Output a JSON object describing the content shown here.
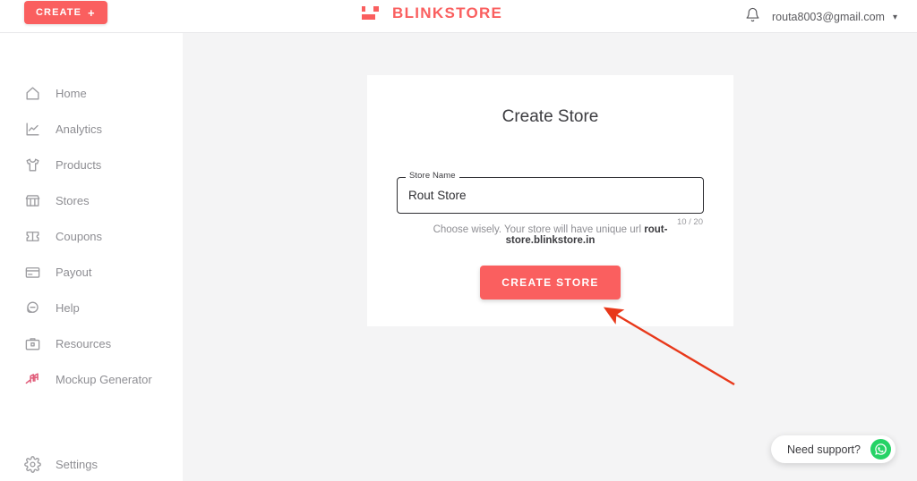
{
  "header": {
    "create_button": {
      "label": "CREATE",
      "icon": "plus-icon",
      "color": "#fa5f5f"
    },
    "brand": {
      "name": "BLINKSTORE",
      "icon": "blinkstore-logo-icon",
      "color": "#fa5f5f"
    },
    "notification_icon": "bell-icon",
    "user_email": "routa8003@gmail.com",
    "user_chevron": "chevron-down-icon"
  },
  "sidebar": {
    "items": [
      {
        "label": "Home",
        "icon": "home-icon"
      },
      {
        "label": "Analytics",
        "icon": "analytics-chart-icon"
      },
      {
        "label": "Products",
        "icon": "tshirt-icon"
      },
      {
        "label": "Stores",
        "icon": "storefront-icon"
      },
      {
        "label": "Coupons",
        "icon": "ticket-icon"
      },
      {
        "label": "Payout",
        "icon": "card-icon"
      },
      {
        "label": "Help",
        "icon": "headset-icon"
      },
      {
        "label": "Resources",
        "icon": "briefcase-icon"
      },
      {
        "label": "Mockup Generator",
        "icon": "mockup-generator-icon"
      }
    ],
    "settings": {
      "label": "Settings",
      "icon": "gear-icon"
    }
  },
  "main": {
    "card_title": "Create Store",
    "store_name_field": {
      "label": "Store Name",
      "value": "Rout Store",
      "placeholder": "Store Name",
      "counter": "10 / 20"
    },
    "helper_prefix": "Choose wisely. Your store will have unique url ",
    "helper_url": "rout-store.blinkstore.in",
    "submit_label": "CREATE STORE"
  },
  "annotation": {
    "type": "arrow",
    "color": "#e8381a",
    "points_to": "create-store-button"
  },
  "support": {
    "label": "Need support?",
    "icon": "whatsapp-icon",
    "color": "#25d366"
  }
}
